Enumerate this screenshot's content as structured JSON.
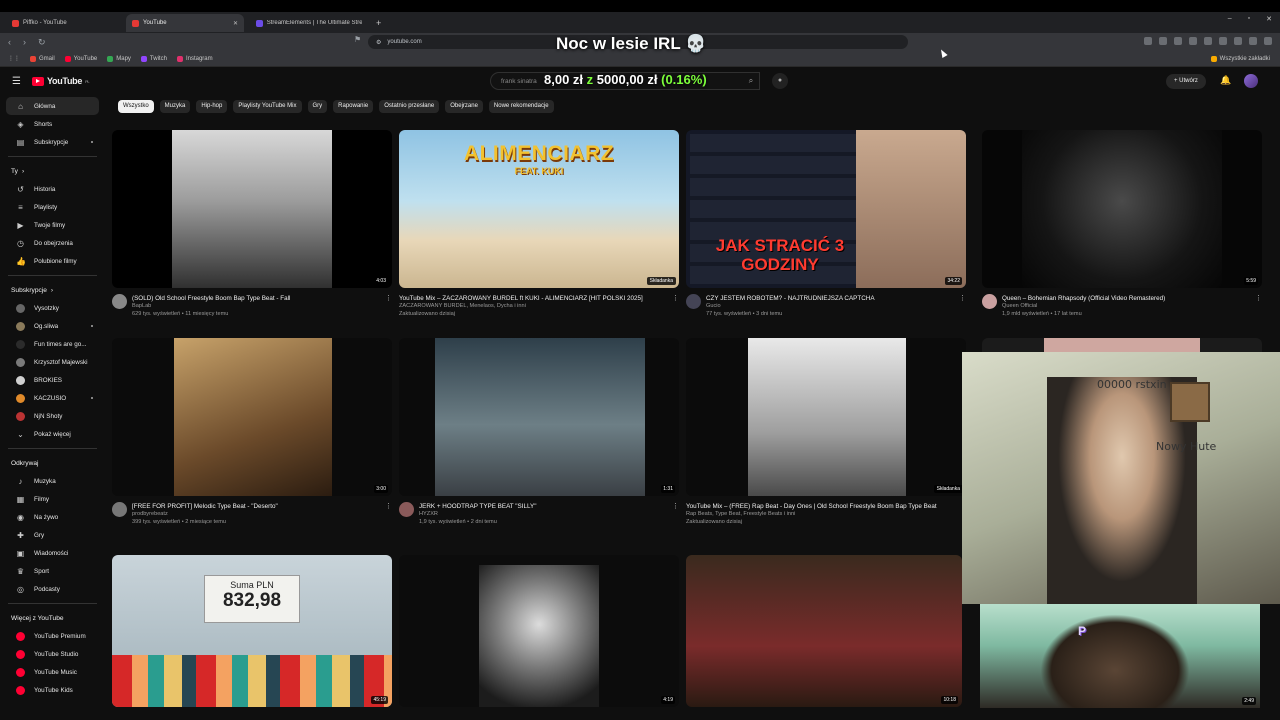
{
  "browser": {
    "tabs": [
      {
        "label": "Piffko - YouTube",
        "active": false
      },
      {
        "label": "YouTube",
        "active": true
      },
      {
        "label": "StreamElements | The Ultimate Strea",
        "active": false
      }
    ],
    "new_tab": "+",
    "url": "youtube.com",
    "bookmarks": [
      "Gmail",
      "YouTube",
      "Mapy",
      "Twitch",
      "Instagram"
    ],
    "all_bookmarks": "Wszystkie zakładki"
  },
  "overlay": {
    "title": "Noc w lesie IRL 💀",
    "donation_raised": "8,00 zł",
    "donation_sep": "z",
    "donation_goal": "5000,00 zł",
    "donation_pct": "(0.16%)"
  },
  "header": {
    "logo": "YouTube",
    "logo_region": "PL",
    "search_placeholder": "frank sinatra",
    "create": "Utwórz"
  },
  "sidebar": {
    "main": [
      {
        "label": "Główna",
        "icon": "home-icon",
        "active": true
      },
      {
        "label": "Shorts",
        "icon": "shorts-icon"
      },
      {
        "label": "Subskrypcje",
        "icon": "subscriptions-icon"
      }
    ],
    "you_head": "Ty",
    "you": [
      {
        "label": "Historia",
        "icon": "history-icon"
      },
      {
        "label": "Playlisty",
        "icon": "playlist-icon"
      },
      {
        "label": "Twoje filmy",
        "icon": "video-icon"
      },
      {
        "label": "Do obejrzenia",
        "icon": "clock-icon"
      },
      {
        "label": "Polubione filmy",
        "icon": "like-icon"
      }
    ],
    "subs_head": "Subskrypcje",
    "subs": [
      {
        "label": "Vysotzky"
      },
      {
        "label": "Og.sliwa"
      },
      {
        "label": "Fun times are go..."
      },
      {
        "label": "Krzysztof Majewski"
      },
      {
        "label": "BROKIES"
      },
      {
        "label": "KACZUSIO"
      },
      {
        "label": "NjN Shoty"
      },
      {
        "label": "Pokaż więcej"
      }
    ],
    "explore_head": "Odkrywaj",
    "explore": [
      {
        "label": "Muzyka",
        "icon": "music-icon"
      },
      {
        "label": "Filmy",
        "icon": "film-icon"
      },
      {
        "label": "Na żywo",
        "icon": "live-icon"
      },
      {
        "label": "Gry",
        "icon": "gamepad-icon"
      },
      {
        "label": "Wiadomości",
        "icon": "news-icon"
      },
      {
        "label": "Sport",
        "icon": "trophy-icon"
      },
      {
        "label": "Podcasty",
        "icon": "podcast-icon"
      }
    ],
    "more_head": "Więcej z YouTube",
    "more": [
      {
        "label": "YouTube Premium"
      },
      {
        "label": "YouTube Studio"
      },
      {
        "label": "YouTube Music"
      },
      {
        "label": "YouTube Kids"
      }
    ]
  },
  "chips": [
    "Wszystko",
    "Muzyka",
    "Hip-hop",
    "Playlisty YouTube Mix",
    "Gry",
    "Rapowanie",
    "Ostatnio przesłane",
    "Obejrzane",
    "Nowe rekomendacje"
  ],
  "videos": [
    {
      "title": "(SOLD) Old School Freestyle Boom Bap Type Beat - Fall",
      "channel": "BapLab",
      "stats": "629 tys. wyświetleń • 11 miesięcy temu",
      "duration": "4:03"
    },
    {
      "title": "YouTube Mix – ZACZAROWANY BURDEL ft KUKI - ALIMENCIARZ [HIT POLSKI 2025]",
      "channel": "ZACZAROWANY BURDEL, Menelaos, Dycha i inni",
      "stats": "Zaktualizowano dzisiaj",
      "thumb_title": "ALIMENCIARZ",
      "thumb_feat": "FEAT. KUKI",
      "badge": "Składanka"
    },
    {
      "title": "CZY JESTEM ROBOTEM? - NAJTRUDNIEJSZA CAPTCHA",
      "channel": "Gucio",
      "stats": "77 tys. wyświetleń • 3 dni temu",
      "duration": "34:22",
      "thumb_caption": "JAK STRACIĆ 3 GODZINY"
    },
    {
      "title": "Queen – Bohemian Rhapsody (Official Video Remastered)",
      "channel": "Queen Official",
      "stats": "1,9 mld wyświetleń • 17 lat temu",
      "duration": "5:59"
    },
    {
      "title": "[FREE FOR PROFIT] Melodic Type Beat - \"Deserto\"",
      "channel": "prodbyrebeatz",
      "stats": "399 tys. wyświetleń • 2 miesiące temu",
      "duration": "3:00"
    },
    {
      "title": "JERK + HOODTRAP TYPE BEAT \"SILLY\"",
      "channel": "HYZXR",
      "stats": "1,9 tys. wyświetleń • 2 dni temu",
      "duration": "1:31"
    },
    {
      "title": "YouTube Mix – (FREE) Rap Beat - Day Ones | Old School Freestyle Boom Bap Type Beat",
      "channel": "Rap Beats, Type Beat, Freestyle Beats i inni",
      "stats": "Zaktualizowano dzisiaj",
      "badge": "Składanka"
    },
    {
      "plate_l1": "Suma PLN",
      "plate_l2": "832,98",
      "duration": "45:19"
    },
    {
      "duration": "4:19"
    },
    {
      "duration": "10:18"
    }
  ],
  "webcam": {
    "scribble": "00000 rstxin",
    "note": "Nowy Hute",
    "logo": "P"
  },
  "cam2_duration": "2:49"
}
